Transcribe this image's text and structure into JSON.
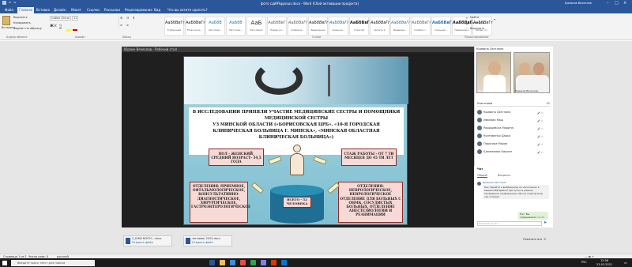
{
  "window": {
    "title": "фото сдй9%ррлшз.docx  -  Word (Сбой активации продукта)",
    "account": "Ермаков Вячеслав"
  },
  "tabs": [
    "Файл",
    "Главная",
    "Вставка",
    "Дизайн",
    "Макет",
    "Ссылки",
    "Рассылки",
    "Рецензирование",
    "Вид",
    "Что вы хотите сделать?"
  ],
  "ribbon": {
    "clipboard": {
      "paste": "Вставить",
      "cut": "Вырезать",
      "copy": "Копировать",
      "format_painter": "Формат по образцу",
      "group": "Буфер обмена"
    },
    "font": {
      "name": "Calibri (Осно",
      "size": "11",
      "group": "Шрифт"
    },
    "paragraph": {
      "group": "Абзац"
    },
    "styles": {
      "group": "Стили",
      "items": [
        {
          "sample": "АаБбВвГг,",
          "name": "¶ Обычный"
        },
        {
          "sample": "АаБбВвГг,",
          "name": "¶ Без инте..."
        },
        {
          "sample": "АаБбВ",
          "name": "Заголово..."
        },
        {
          "sample": "АаБбВ",
          "name": "Заголово..."
        },
        {
          "sample": "АаБ",
          "name": "Заголовок"
        },
        {
          "sample": "АаБбВвГ",
          "name": "Подзагол..."
        },
        {
          "sample": "АаБбВвГг",
          "name": "Слабое в..."
        },
        {
          "sample": "АаБбВвГг",
          "name": "Выделение"
        },
        {
          "sample": "АаБбВвГг",
          "name": "Сильное..."
        },
        {
          "sample": "АаБбВвГг",
          "name": "Строгий"
        },
        {
          "sample": "АаБбВвГг",
          "name": "Цитата 2"
        },
        {
          "sample": "АаБбВвГг",
          "name": "Выделен..."
        },
        {
          "sample": "АаБбВвГг",
          "name": "Слабая с..."
        },
        {
          "sample": "АаБбВвГг",
          "name": "Сильная..."
        },
        {
          "sample": "АаБбВвГг",
          "name": "Название..."
        },
        {
          "sample": "АаБбВвГг",
          "name": "Абзац сп..."
        }
      ]
    },
    "editing": {
      "find": "Найти",
      "replace": "Заменить",
      "select": "Выделить",
      "group": "Редактирование"
    }
  },
  "meeting": {
    "window_title": "Юрзин Вячеслав - Рабочий стол",
    "presenter_name": "Кривина Светлана",
    "video1_label": "Кривина Светлана",
    "video2_label": "Ермаков Вячеслав",
    "participants_header": "Участники",
    "participants_count": "12",
    "participants": [
      "Кривина Светлана",
      "Иванова Маш",
      "Радишевска Марина",
      "Колтовенко Дарья",
      "Пирогова Мария",
      "Шахманова Кирилл"
    ],
    "chat_header": "Чат",
    "chat_tabs": [
      "Общий",
      "Вопросы"
    ],
    "chat_sender": "Кривина Светлана",
    "chat_message": "Как перейти к выбранному из нескольких в вашем СВИ файле? Доступно в рамках проведения конференции. Мы не подключены как спикер?",
    "chat_reply": "Нет. Вы спрашиваете",
    "chat_reply_time": "12:49",
    "chat_input_placeholder": "Написать в чат"
  },
  "slide": {
    "heading": "В ИССЛЕДОВАНИИ ПРИНЯЛИ УЧАСТИЕ МЕДИЦИНСКИЕ СЕСТРЫ И ПОМОЩНИКИ МЕДИЦИНСКОЙ СЕСТРЫ",
    "line2": "УЗ МИНСКОЙ ОБЛАСТИ («БОРИСОВСКАЯ ЦРБ», «10-Я ГОРОДСКАЯ",
    "line3": "КЛИНИЧЕСКАЯ БОЛЬНИЦА Г. МИНСКА», «МИНСКАЯ ОБЛАСТНАЯ",
    "line4": "КЛИНИЧЕСКАЯ БОЛЬНИЦА»)",
    "box_gender": "ПОЛ - ЖЕНСКИЙ, СРЕДНИЙ ВОЗРАСТ- 34,5 ГОДА",
    "box_experience": "СТАЖ РАБОТЫ - ОТ 7 ТИ МЕСЯЦЕВ ДО 45 ТИ ЛЕТ",
    "box_departments_left": "ОТДЕЛЕНИЯ: ПРИЕМНОЕ, ОФТАЛЬМОЛОГИЧЕСКОЕ, КОНСУЛЬТАТИВНО-ДИАГНОСТИЧЕСКОЕ, ХИРУРГИЧЕСКОЕ, ГАСТРОЭНТЕРОЛОГИЧЕСКОЕ",
    "box_departments_right": "ОТДЕЛЕНИЯ: НЕВРОЛОГИЧЕСКОЕ, НЕВРОЛОГИЧЕСКОЕ ОТДЕЛЕНИЕ ДЛЯ БОЛЬНЫХ С ОНМК, СОСУДИСТЫХ БОЛЬНЫХ, ОТДЕЛЕНИЕ АНЕСТЕЗИОЛОГИИ И РЕАНИМАЦИИ",
    "total_label": "ВСЕГО - 52 ЧЕЛОВЕКА"
  },
  "open_docs": [
    {
      "name": "2_БЖИ NOITIC...docx",
      "sub": "Открыть файл"
    },
    {
      "name": "заглавок 2020.docx",
      "sub": "Открыть файл"
    }
  ],
  "show_all": "Показать все",
  "status": {
    "page": "Страница 1 из 1",
    "words": "Число слов: 0",
    "lang": "русский"
  },
  "taskbar": {
    "search_placeholder": "Введите здесь текст для поиска",
    "time": "12:56",
    "date": "23.03.2021",
    "lang": "РУС"
  }
}
